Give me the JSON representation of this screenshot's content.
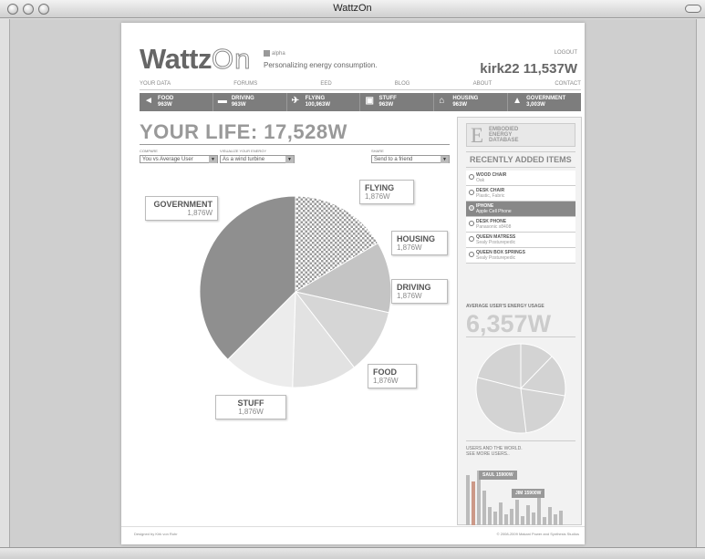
{
  "window": {
    "title": "WattzOn"
  },
  "brand": {
    "logo_a": "Wattz",
    "logo_b": "On",
    "alpha": "alpha",
    "tagline": "Personalizing energy consumption."
  },
  "header": {
    "logout": "LOGOUT",
    "user": "kirk22 11,537W"
  },
  "nav": [
    {
      "label": "YOUR DATA"
    },
    {
      "label": "FORUMS"
    },
    {
      "label": "EED"
    },
    {
      "label": "BLOG"
    },
    {
      "label": "ABOUT"
    },
    {
      "label": "CONTACT"
    }
  ],
  "categories": [
    {
      "name": "FOOD",
      "value": "963W",
      "icon": "carrot-icon"
    },
    {
      "name": "DRIVING",
      "value": "963W",
      "icon": "car-icon"
    },
    {
      "name": "FLYING",
      "value": "100,963W",
      "icon": "plane-icon"
    },
    {
      "name": "STUFF",
      "value": "963W",
      "icon": "sofa-icon"
    },
    {
      "name": "HOUSING",
      "value": "963W",
      "icon": "house-icon"
    },
    {
      "name": "GOVERNMENT",
      "value": "3,003W",
      "icon": "capitol-icon"
    }
  ],
  "summary": {
    "title": "YOUR LIFE: 17,528W"
  },
  "controls": {
    "compare_label": "COMPARE",
    "compare_value": "You vs Average User",
    "visualize_label": "VISUALIZE YOUR ENERGY",
    "visualize_value": "As a wind turbine",
    "share_label": "SHARE",
    "share_value": "Send to a friend"
  },
  "chart_data": {
    "type": "pie",
    "slices": [
      {
        "label": "FLYING",
        "value": 16.5,
        "display": "1,876W"
      },
      {
        "label": "HOUSING",
        "value": 12,
        "display": "1,876W"
      },
      {
        "label": "DRIVING",
        "value": 11,
        "display": "1,876W"
      },
      {
        "label": "FOOD",
        "value": 11,
        "display": "1,876W"
      },
      {
        "label": "STUFF",
        "value": 12,
        "display": "1,876W"
      },
      {
        "label": "GOVERNMENT",
        "value": 37.5,
        "display": "1,876W"
      }
    ]
  },
  "sidebar": {
    "eed_letter": "E",
    "eed_lines": [
      "EMBODIED",
      "ENERGY",
      "DATABASE"
    ],
    "recent_title": "RECENTLY ADDED ITEMS",
    "items": [
      {
        "name": "WOOD CHAIR",
        "sub": "Oak",
        "selected": false
      },
      {
        "name": "DESK CHAIR",
        "sub": "Plastic, Fabric",
        "selected": false
      },
      {
        "name": "IPHONE",
        "sub": "Apple Cell Phone",
        "selected": true
      },
      {
        "name": "DESK PHONE",
        "sub": "Panasonic x8408",
        "selected": false
      },
      {
        "name": "QUEEN MATRESS",
        "sub": "Sealy Posturepedic",
        "selected": false
      },
      {
        "name": "QUEEN BOX SPRINGS",
        "sub": "Sealy Posturepedic",
        "selected": false
      }
    ],
    "avg_label": "AVERAGE USER'S ENERGY USAGE",
    "avg_value": "6,357W",
    "world_line1": "USERS AND THE WORLD.",
    "world_line2": "SEE MORE USERS..",
    "tag_saul": "SAUL 15900W",
    "tag_jim": "JIM 15900W"
  },
  "footer": {
    "left": "Designed by Kirk von Rohr",
    "right": "© 2008-2009 Makani Power and Synthesis Studios"
  }
}
